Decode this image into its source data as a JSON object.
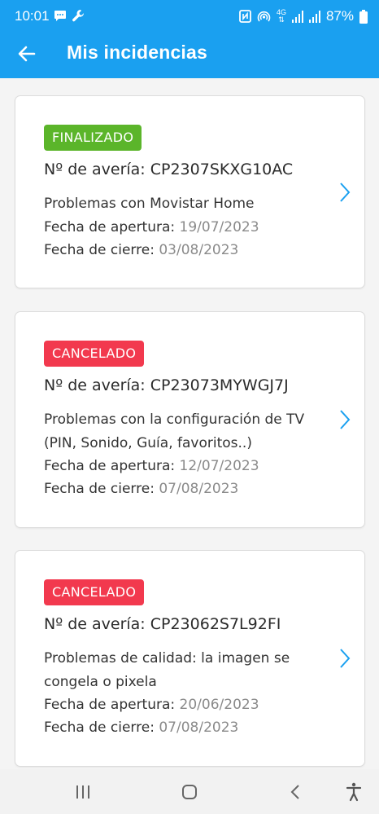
{
  "status_bar": {
    "time": "10:01",
    "battery": "87%",
    "network": "4G",
    "left_icons": [
      "message-icon",
      "wrench-icon"
    ],
    "right_icons": [
      "nfc-icon",
      "hotspot-icon",
      "signal-icon",
      "signal-icon",
      "battery-icon"
    ]
  },
  "app_bar": {
    "title": "Mis incidencias",
    "back_icon": "arrow-left-icon",
    "color": "#1aa0f0"
  },
  "incidents": [
    {
      "status": "FINALIZADO",
      "status_color": "#5bb52a",
      "ref_label": "Nº de avería: CP2307SKXG10AC",
      "desc_lines": [
        "Problemas con Movistar Home"
      ],
      "open_label": "Fecha de apertura:",
      "open_date": "19/07/2023",
      "close_label": "Fecha de cierre:",
      "close_date": "03/08/2023"
    },
    {
      "status": "CANCELADO",
      "status_color": "#f2394e",
      "ref_label": "Nº de avería: CP23073MYWGJ7J",
      "desc_lines": [
        "Problemas con la configuración de TV",
        "(PIN, Sonido, Guía, favoritos..)"
      ],
      "open_label": "Fecha de apertura:",
      "open_date": "12/07/2023",
      "close_label": "Fecha de cierre:",
      "close_date": "07/08/2023"
    },
    {
      "status": "CANCELADO",
      "status_color": "#f2394e",
      "ref_label": "Nº de avería: CP23062S7L92FI",
      "desc_lines": [
        "Problemas de calidad: la imagen se",
        "congela o pixela"
      ],
      "open_label": "Fecha de apertura:",
      "open_date": "20/06/2023",
      "close_label": "Fecha de cierre:",
      "close_date": "07/08/2023"
    }
  ],
  "nav_bar": {
    "buttons": [
      "recent-apps-icon",
      "home-icon",
      "back-icon",
      "accessibility-icon"
    ]
  }
}
